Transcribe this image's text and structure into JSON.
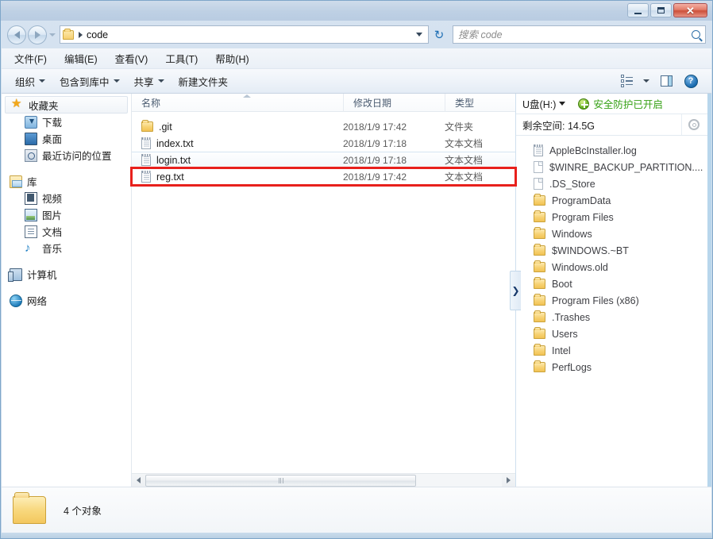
{
  "window": {
    "title": "",
    "controls": {
      "minimize": "−",
      "maximize": "□",
      "close": "✕"
    }
  },
  "address": {
    "back_label": "后退",
    "forward_label": "前进",
    "history_label": "最近浏览的位置",
    "crumb_root_icon": "folder-icon",
    "crumb": "code",
    "dropdown_label": "▾",
    "refresh_label": "↻"
  },
  "search": {
    "placeholder": "搜索 code",
    "value": "",
    "icon": "search-icon"
  },
  "menubar": {
    "items": [
      {
        "label": "文件(F)"
      },
      {
        "label": "编辑(E)"
      },
      {
        "label": "查看(V)"
      },
      {
        "label": "工具(T)"
      },
      {
        "label": "帮助(H)"
      }
    ]
  },
  "toolbar": {
    "items": [
      {
        "label": "组织",
        "has_caret": true
      },
      {
        "label": "包含到库中",
        "has_caret": true
      },
      {
        "label": "共享",
        "has_caret": true
      },
      {
        "label": "新建文件夹",
        "has_caret": false
      }
    ],
    "view_icon": "view-list-icon",
    "view_caret": "▾",
    "preview_icon": "preview-pane-icon",
    "help_icon": "help-icon",
    "help_glyph": "?"
  },
  "navpane": {
    "groups": [
      {
        "header": {
          "label": "收藏夹",
          "icon": "star-icon",
          "selected": true
        },
        "children": [
          {
            "label": "下载",
            "icon": "download-icon"
          },
          {
            "label": "桌面",
            "icon": "desktop-icon"
          },
          {
            "label": "最近访问的位置",
            "icon": "recent-places-icon"
          }
        ]
      },
      {
        "header": {
          "label": "库",
          "icon": "library-icon",
          "selected": false
        },
        "children": [
          {
            "label": "视频",
            "icon": "video-icon"
          },
          {
            "label": "图片",
            "icon": "picture-icon"
          },
          {
            "label": "文档",
            "icon": "document-icon"
          },
          {
            "label": "音乐",
            "icon": "music-icon"
          }
        ]
      },
      {
        "header": {
          "label": "计算机",
          "icon": "computer-icon",
          "selected": false
        },
        "children": []
      },
      {
        "header": {
          "label": "网络",
          "icon": "network-icon",
          "selected": false
        },
        "children": []
      }
    ]
  },
  "filelist": {
    "columns": [
      {
        "label": "名称",
        "sorted": true
      },
      {
        "label": "修改日期",
        "sorted": false
      },
      {
        "label": "类型",
        "sorted": false
      }
    ],
    "rows": [
      {
        "name": ".git",
        "date": "2018/1/9 17:42",
        "type": "文件夹",
        "icon": "folder-icon",
        "selected": false,
        "highlighted": false
      },
      {
        "name": "index.txt",
        "date": "2018/1/9 17:18",
        "type": "文本文档",
        "icon": "text-file-icon",
        "selected": false,
        "highlighted": false
      },
      {
        "name": "login.txt",
        "date": "2018/1/9 17:18",
        "type": "文本文档",
        "icon": "text-file-icon",
        "selected": true,
        "highlighted": false
      },
      {
        "name": "reg.txt",
        "date": "2018/1/9 17:42",
        "type": "文本文档",
        "icon": "text-file-icon",
        "selected": false,
        "highlighted": true
      }
    ],
    "highlight_color": "#e8201c"
  },
  "usbpane": {
    "drive_label": "U盘(H:)",
    "protection_text": "安全防护已开启",
    "protection_color": "#34a013",
    "protection_icon": "shield-plus-icon",
    "free_space_label": "剩余空间: 14.5G",
    "settings_icon": "gear-icon",
    "collapse_icon": "chevron-right-icon",
    "collapse_glyph": "❯",
    "items": [
      {
        "label": "AppleBcInstaller.log",
        "icon": "log-file-icon"
      },
      {
        "label": "$WINRE_BACKUP_PARTITION....",
        "icon": "blank-file-icon"
      },
      {
        "label": ".DS_Store",
        "icon": "blank-file-icon"
      },
      {
        "label": "ProgramData",
        "icon": "folder-icon"
      },
      {
        "label": "Program Files",
        "icon": "folder-icon"
      },
      {
        "label": "Windows",
        "icon": "folder-icon"
      },
      {
        "label": "$WINDOWS.~BT",
        "icon": "folder-icon"
      },
      {
        "label": "Windows.old",
        "icon": "folder-icon"
      },
      {
        "label": "Boot",
        "icon": "folder-icon"
      },
      {
        "label": "Program Files (x86)",
        "icon": "folder-icon"
      },
      {
        "label": ".Trashes",
        "icon": "folder-icon"
      },
      {
        "label": "Users",
        "icon": "folder-icon"
      },
      {
        "label": "Intel",
        "icon": "folder-icon"
      },
      {
        "label": "PerfLogs",
        "icon": "folder-icon"
      }
    ]
  },
  "scrollbar": {
    "left_arrow": "◀",
    "right_arrow": "▶",
    "thumb_grip": "|||"
  },
  "statusbar": {
    "folder_icon": "folder-icon",
    "item_count_text": "4 个对象"
  }
}
